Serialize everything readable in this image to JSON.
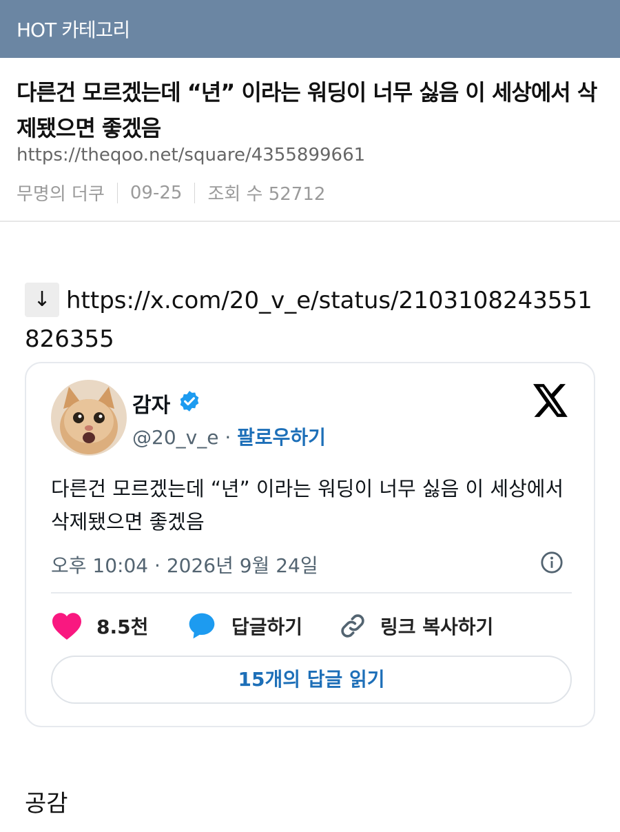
{
  "header": {
    "category": "HOT 카테고리"
  },
  "post": {
    "title": "다른건 모르겠는데 “년” 이라는 워딩이 너무 싫음 이 세상에서 삭제됐으면 좋겠음",
    "url": "https://theqoo.net/square/4355899661",
    "author": "무명의 더쿠",
    "date": "09-25",
    "views": "조회 수 52712",
    "link_arrow": "↓",
    "link": "https://x.com/20_v_e/status/2103108243551826355"
  },
  "tweet": {
    "name": "감자",
    "handle": "@20_v_e",
    "dot": " · ",
    "follow": "팔로우하기",
    "text": "다른건 모르겠는데 “년” 이라는 워딩이 너무 싫음 이 세상에서 삭제됐으면 좋겠음",
    "time": "오후 10:04 · 2026년 9월 24일",
    "likes": "8.5천",
    "reply": "답글하기",
    "copy_link": "링크 복사하기",
    "read_replies": "15개의 답글 읽기",
    "icons": {
      "like": "heart-icon",
      "reply": "speech-bubble-icon",
      "copy": "link-icon",
      "info": "info-icon",
      "brand": "x-logo-icon",
      "verified": "verified-badge-icon"
    },
    "colors": {
      "like": "#f91880",
      "reply": "#1d9bf0",
      "accent": "#1d6fb8"
    }
  },
  "footer": {
    "label": "공감"
  },
  "colors": {
    "header_bg": "#6b86a3"
  }
}
